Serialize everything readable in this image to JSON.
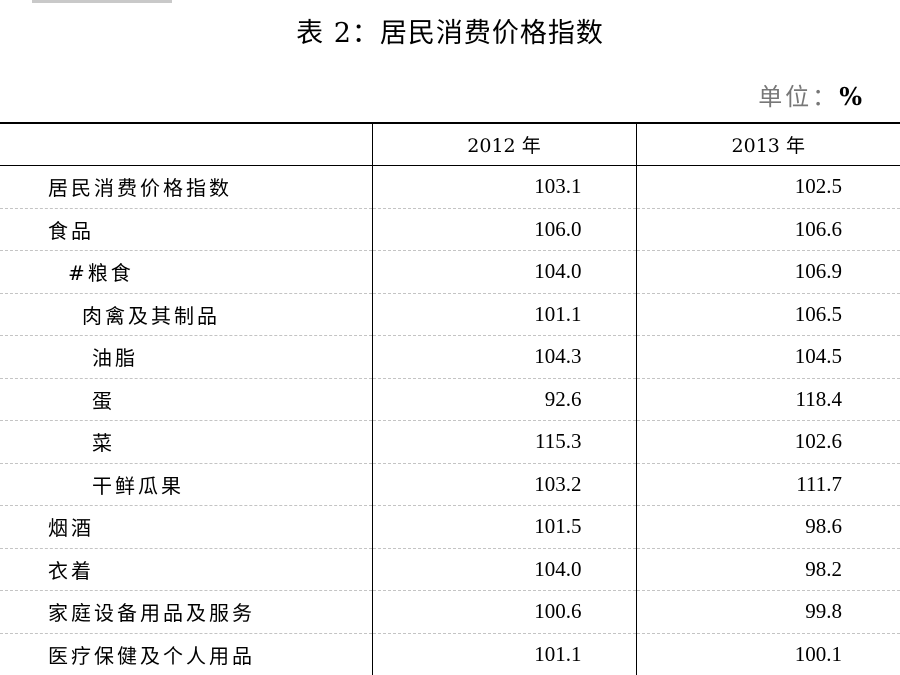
{
  "title": "表 2：居民消费价格指数",
  "unit": {
    "label": "单位：",
    "symbol": "%"
  },
  "headers": [
    "",
    "2012 年",
    "2013 年"
  ],
  "rows": [
    {
      "name": "居民消费价格指数",
      "level": 0,
      "v2012": "103.1",
      "v2013": "102.5"
    },
    {
      "name": "食品",
      "level": 0,
      "v2012": "106.0",
      "v2013": "106.6"
    },
    {
      "name": "#粮食",
      "level": 1,
      "v2012": "104.0",
      "v2013": "106.9"
    },
    {
      "name": "肉禽及其制品",
      "level": 2,
      "v2012": "101.1",
      "v2013": "106.5"
    },
    {
      "name": "油脂",
      "level": 3,
      "v2012": "104.3",
      "v2013": "104.5"
    },
    {
      "name": "蛋",
      "level": 3,
      "v2012": "92.6",
      "v2013": "118.4"
    },
    {
      "name": "菜",
      "level": 3,
      "v2012": "115.3",
      "v2013": "102.6"
    },
    {
      "name": "干鲜瓜果",
      "level": 3,
      "v2012": "103.2",
      "v2013": "111.7"
    },
    {
      "name": "烟酒",
      "level": 0,
      "v2012": "101.5",
      "v2013": "98.6"
    },
    {
      "name": "衣着",
      "level": 0,
      "v2012": "104.0",
      "v2013": "98.2"
    },
    {
      "name": "家庭设备用品及服务",
      "level": 0,
      "v2012": "100.6",
      "v2013": "99.8"
    },
    {
      "name": "医疗保健及个人用品",
      "level": 0,
      "v2012": "101.1",
      "v2013": "100.1"
    }
  ]
}
